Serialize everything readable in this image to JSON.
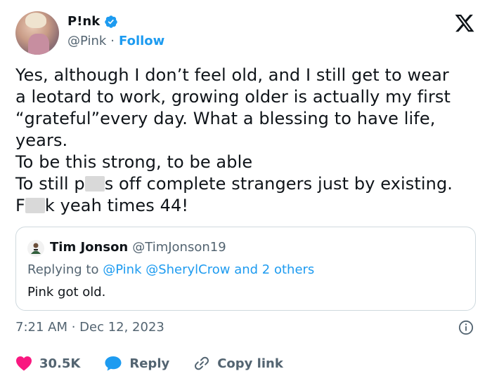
{
  "author": {
    "display_name": "P!nk",
    "handle": "@Pink",
    "separator": "·",
    "follow_label": "Follow"
  },
  "tweet": {
    "line1": "Yes, although I don’t feel old, and I still get to wear",
    "line2": "a leotard to work, growing older is actually my first",
    "line3": "“grateful”every day. What a blessing to have life,",
    "line4": "years.",
    "line5": "To be this strong, to be able",
    "line6_start": "To still p",
    "line6_end": "s off complete strangers just by existing.",
    "line7_start": "F",
    "line7_end": "k yeah times 44!"
  },
  "quote": {
    "name": "Tim Jonson",
    "handle": "@TimJonson19",
    "replying_prefix": "Replying to ",
    "replying_users": "@Pink @SherylCrow",
    "replying_suffix": " and 2 others",
    "text": "Pink got old."
  },
  "meta": {
    "timestamp": "7:21 AM · Dec 12, 2023"
  },
  "actions": {
    "likes": "30.5K",
    "reply_label": "Reply",
    "copy_label": "Copy link"
  },
  "colors": {
    "accent": "#1d9bf0",
    "like": "#f91880",
    "muted": "#536471"
  }
}
